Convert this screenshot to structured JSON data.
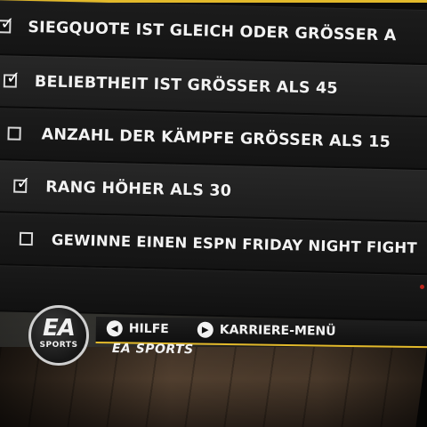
{
  "goals": [
    {
      "label": "SIEGQUOTE IST GLEICH ODER GRÖSSER A",
      "checked": true
    },
    {
      "label": "BELIEBTHEIT IST GRÖSSER ALS 45",
      "checked": true
    },
    {
      "label": "ANZAHL DER KÄMPFE GRÖSSER ALS 15",
      "checked": false
    },
    {
      "label": "RANG HÖHER ALS 30",
      "checked": true
    },
    {
      "label": "GEWINNE EINEN ESPN FRIDAY NIGHT FIGHT",
      "checked": false
    }
  ],
  "ea_logo": {
    "top": "EA",
    "bottom": "SPORTS"
  },
  "hints": {
    "help_label": "HILFE",
    "career_menu_label": "KARRIERE-MENÜ"
  },
  "brand_text": "EA SPORTS",
  "colors": {
    "accent": "#e2b92b",
    "text": "#f2f2f2",
    "panel": "#1c1c1c"
  }
}
